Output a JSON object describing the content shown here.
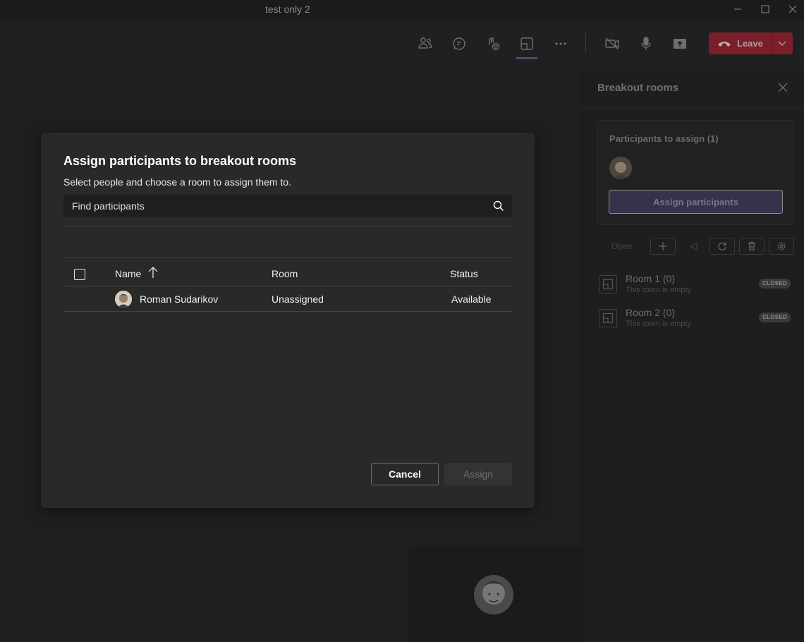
{
  "window": {
    "title": "test only 2"
  },
  "toolbar": {
    "icons": [
      "people-icon",
      "chat-icon",
      "reactions-icon",
      "breakout-rooms-icon",
      "more-icon",
      "camera-off-icon",
      "mic-icon",
      "share-icon"
    ],
    "leave_label": "Leave"
  },
  "panel": {
    "title": "Breakout rooms",
    "participants_header": "Participants to assign (1)",
    "assign_button": "Assign participants",
    "open_label": "Open",
    "rooms": [
      {
        "name": "Room 1 (0)",
        "subtitle": "This room is empty",
        "status": "CLOSED"
      },
      {
        "name": "Room 2 (0)",
        "subtitle": "This room is empty",
        "status": "CLOSED"
      }
    ]
  },
  "dialog": {
    "title": "Assign participants to breakout rooms",
    "subtitle": "Select people and choose a room to assign them to.",
    "search_placeholder": "Find participants",
    "columns": {
      "name": "Name",
      "room": "Room",
      "status": "Status"
    },
    "rows": [
      {
        "name": "Roman Sudarikov",
        "room": "Unassigned",
        "status": "Available"
      }
    ],
    "cancel_label": "Cancel",
    "assign_label": "Assign"
  },
  "colors": {
    "accent": "#4b4970",
    "leave": "#7a1f2a",
    "dialog_bg": "#292929"
  }
}
